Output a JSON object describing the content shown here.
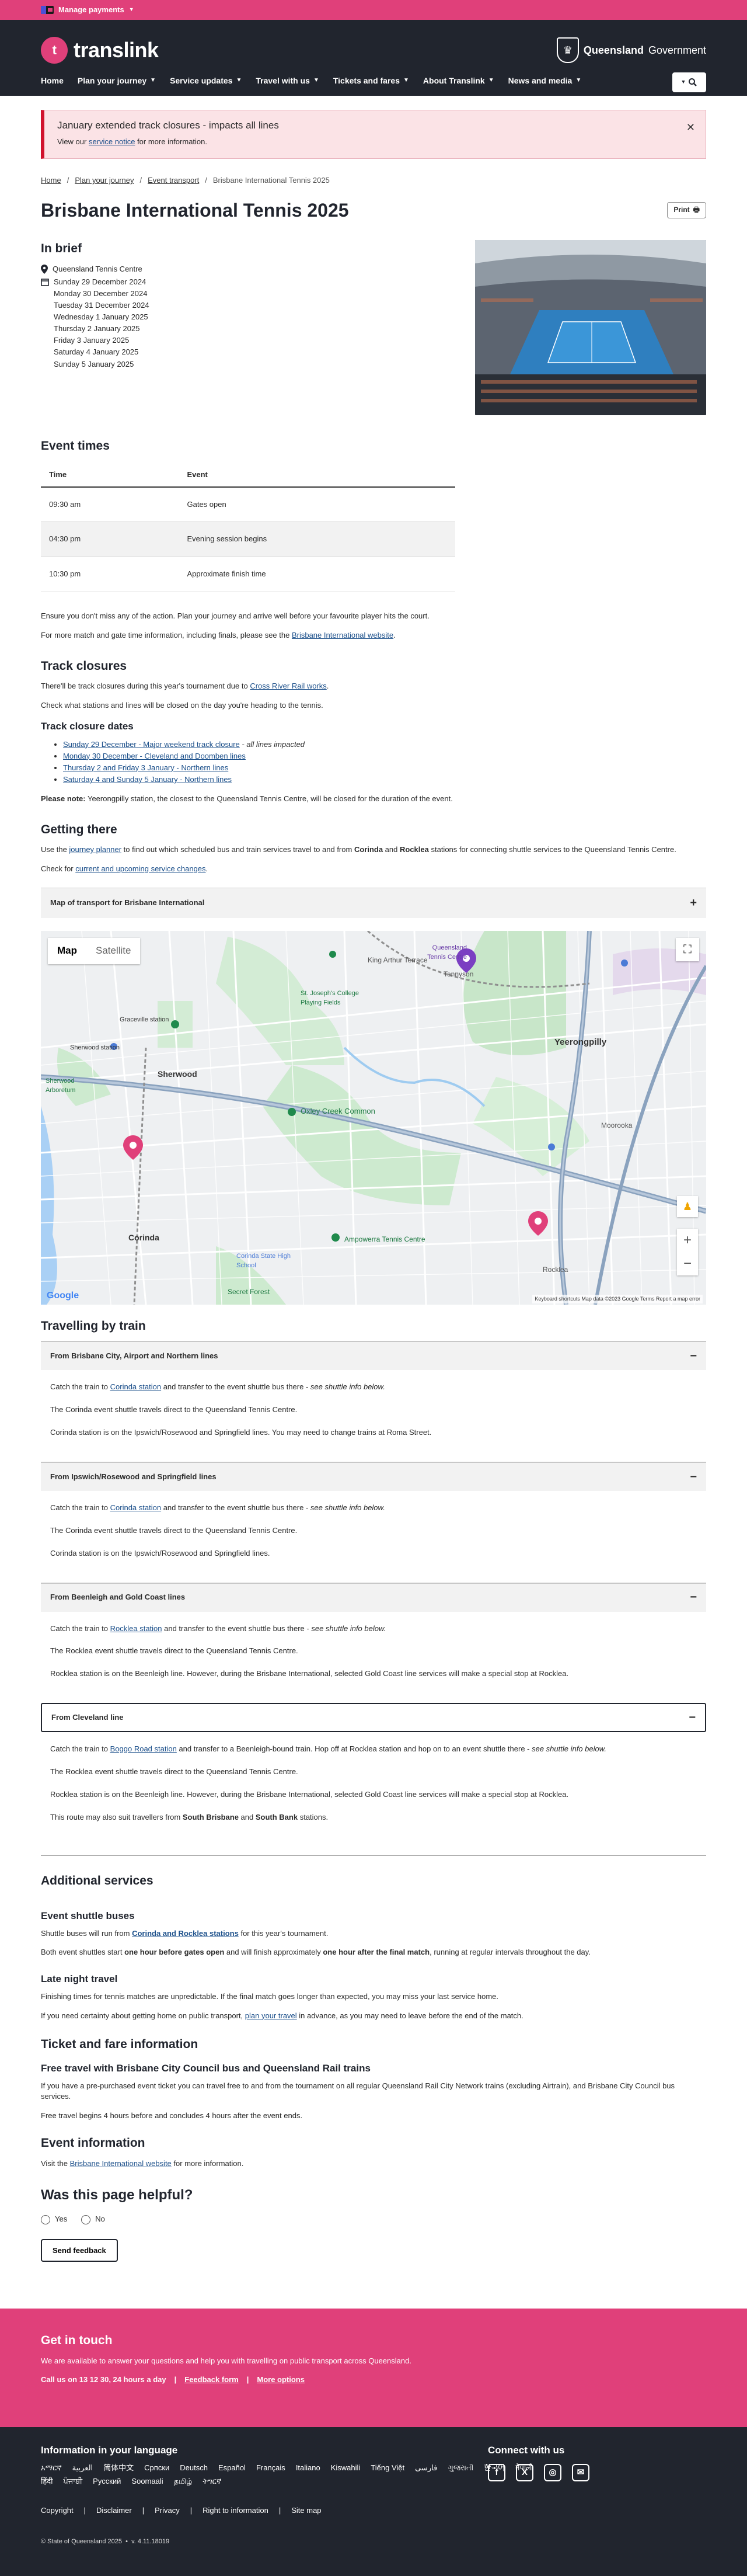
{
  "utility": {
    "manage_payments": "Manage payments"
  },
  "header": {
    "logo": "translink",
    "gov1": "Queensland",
    "gov2": "Government",
    "nav": [
      "Home",
      "Plan your journey",
      "Service updates",
      "Travel with us",
      "Tickets and fares",
      "About Translink",
      "News and media"
    ]
  },
  "alert": {
    "title": "January extended track closures - impacts all lines",
    "body_pre": "View our ",
    "body_link": "service notice",
    "body_post": " for more information."
  },
  "breadcrumb": [
    "Home",
    "Plan your journey",
    "Event transport",
    "Brisbane International Tennis 2025"
  ],
  "page": {
    "title": "Brisbane International Tennis 2025",
    "print": "Print"
  },
  "brief": {
    "heading": "In brief",
    "venue": "Queensland Tennis Centre",
    "dates": [
      "Sunday 29 December 2024",
      "Monday 30 December 2024",
      "Tuesday 31 December 2024",
      "Wednesday 1 January 2025",
      "Thursday 2 January 2025",
      "Friday 3 January 2025",
      "Saturday 4 January 2025",
      "Sunday 5 January 2025"
    ]
  },
  "times": {
    "heading": "Event times",
    "col_time": "Time",
    "col_event": "Event",
    "rows": [
      {
        "time": "09:30 am",
        "event": "Gates open"
      },
      {
        "time": "04:30 pm",
        "event": "Evening session begins"
      },
      {
        "time": "10:30 pm",
        "event": "Approximate finish time"
      }
    ],
    "p1": "Ensure you don't miss any of the action. Plan your journey and arrive well before your favourite player hits the court.",
    "p2_pre": "For more match and gate time information, including finals, please see the ",
    "p2_link": "Brisbane International website",
    "p2_post": "."
  },
  "closures": {
    "heading": "Track closures",
    "p1_pre": "There'll be track closures during this year's tournament due to ",
    "p1_link": "Cross River Rail works",
    "p1_post": ".",
    "p2": "Check what stations and lines will be closed on the day you're heading to the tennis.",
    "sub": "Track closure dates",
    "items": [
      {
        "text": "Sunday 29 December - Major weekend track closure",
        "note": " - all lines impacted"
      },
      {
        "text": "Monday 30 December - Cleveland and Doomben lines",
        "note": ""
      },
      {
        "text": "Thursday 2 and Friday 3 January - Northern lines",
        "note": ""
      },
      {
        "text": "Saturday 4 and Sunday 5 January - Northern lines",
        "note": ""
      }
    ],
    "note_bold": "Please note:",
    "note_text": " Yeerongpilly station, the closest to the Queensland Tennis Centre, will be closed for the duration of the event."
  },
  "getting": {
    "heading": "Getting there",
    "p1_pre": "Use the ",
    "p1_link": "journey planner",
    "p1_mid": " to find out which scheduled bus and train services travel to and from ",
    "p1_b1": "Corinda",
    "p1_and": " and ",
    "p1_b2": "Rocklea",
    "p1_post": " stations for connecting shuttle services to the Queensland Tennis Centre.",
    "p2_pre": "Check for ",
    "p2_link": "current and upcoming service changes",
    "p2_post": "."
  },
  "map": {
    "accordion": "Map of transport for Brisbane International",
    "tab_map": "Map",
    "tab_sat": "Satellite",
    "labels": [
      "Sherwood",
      "Corinda",
      "Yeerongpilly",
      "Moorooka",
      "Rocklea",
      "Oxley Creek Common",
      "Queensland Tennis Centre",
      "Tennyson",
      "St. Joseph's College Playing Fields",
      "Sherwood Arboretum",
      "Corinda State High School",
      "Secret Forest",
      "Ampowerra Tennis Centre",
      "King Arthur Terrace",
      "Sherwood station",
      "Graceville station"
    ],
    "google": "Google",
    "copy": "Keyboard shortcuts   Map data ©2023 Google   Terms   Report a map error"
  },
  "train": {
    "heading": "Travelling by train",
    "sections": [
      {
        "title": "From Brisbane City, Airport and Northern lines",
        "l1_pre": "Catch the train to ",
        "l1_link": "Corinda station",
        "l1_post": " and transfer to the event shuttle bus there - ",
        "l1_em": "see shuttle info below.",
        "l2": "The Corinda event shuttle travels direct to the Queensland Tennis Centre.",
        "l3": "Corinda station is on the Ipswich/Rosewood and Springfield lines. You may need to change trains at Roma Street."
      },
      {
        "title": "From Ipswich/Rosewood and Springfield lines",
        "l1_pre": "Catch the train to ",
        "l1_link": "Corinda station",
        "l1_post": " and transfer to the event shuttle bus there - ",
        "l1_em": "see shuttle info below.",
        "l2": "The Corinda event shuttle travels direct to the Queensland Tennis Centre.",
        "l3": "Corinda station is on the Ipswich/Rosewood and Springfield lines."
      },
      {
        "title": "From Beenleigh and Gold Coast lines",
        "l1_pre": "Catch the train to ",
        "l1_link": "Rocklea station",
        "l1_post": " and transfer to the event shuttle bus there - ",
        "l1_em": "see shuttle info below.",
        "l2": "The Rocklea event shuttle travels direct to the Queensland Tennis Centre.",
        "l3": "Rocklea station is on the Beenleigh line. However, during the Brisbane International, selected Gold Coast line services will make a special stop at Rocklea."
      },
      {
        "title": "From Cleveland line",
        "l1_pre": "Catch the train to ",
        "l1_link": "Boggo Road station",
        "l1_post": " and transfer to a Beenleigh-bound train. Hop off at Rocklea station and hop on to an event shuttle there - ",
        "l1_em": "see shuttle info below.",
        "l2": "The Rocklea event shuttle travels direct to the Queensland Tennis Centre.",
        "l3": "Rocklea station is on the Beenleigh line. However, during the Brisbane International, selected Gold Coast line services will make a special stop at Rocklea.",
        "l4_pre": "This route may also suit travellers from ",
        "l4_b1": "South Brisbane",
        "l4_and": " and ",
        "l4_b2": "South Bank",
        "l4_post": " stations."
      }
    ]
  },
  "additional": {
    "heading": "Additional services",
    "shuttle_h": "Event shuttle buses",
    "shuttle_p1_pre": "Shuttle buses will run from ",
    "shuttle_p1_b": "Corinda and Rocklea stations",
    "shuttle_p1_post": " for this year's tournament.",
    "shuttle_p2_pre": "Both event shuttles start ",
    "shuttle_p2_b1": "one hour before gates open",
    "shuttle_p2_mid": " and will finish approximately ",
    "shuttle_p2_b2": "one hour after the final match",
    "shuttle_p2_post": ", running at regular intervals throughout the day.",
    "late_h": "Late night travel",
    "late_p1": "Finishing times for tennis matches are unpredictable. If the final match goes longer than expected, you may miss your last service home.",
    "late_p2_pre": "If you need certainty about getting home on public transport, ",
    "late_p2_link": "plan your travel",
    "late_p2_post": " in advance, as you may need to leave before the end of the match.",
    "ticket_h": "Ticket and fare information",
    "free_h": "Free travel with Brisbane City Council bus and Queensland Rail trains",
    "free_p1": "If you have a pre-purchased event ticket you can travel free to and from the tournament on all regular Queensland Rail City Network trains (excluding Airtrain), and Brisbane City Council bus services.",
    "free_p2": "Free travel begins 4 hours before and concludes 4 hours after the event ends.",
    "info_h": "Event information",
    "info_p_pre": "Visit the ",
    "info_p_link": "Brisbane International website",
    "info_p_post": " for more information."
  },
  "feedback": {
    "heading": "Was this page helpful?",
    "yes": "Yes",
    "no": "No",
    "send": "Send feedback"
  },
  "touch": {
    "heading": "Get in touch",
    "body": "We are available to answer your questions and help you with travelling on public transport across Queensland.",
    "call": "Call us on 13 12 30, 24 hours a day",
    "feedback": "Feedback form",
    "more": "More options"
  },
  "footer": {
    "lang_heading": "Information in your language",
    "langs": [
      "አማርኛ",
      "العربية",
      "简体中文",
      "Српски",
      "Deutsch",
      "Español",
      "Français",
      "Italiano",
      "Kiswahili",
      "Tiếng Việt",
      "فارسی",
      "ગુજરાતી",
      "한국어",
      "नेपाली",
      "हिंदी",
      "ਪੰਜਾਬੀ",
      "Русский",
      "Soomaali",
      "தமிழ்",
      "ትግርኛ"
    ],
    "connect": "Connect with us",
    "links": [
      "Copyright",
      "Disclaimer",
      "Privacy",
      "Right to information",
      "Site map"
    ],
    "copyright": "© State of Queensland 2025",
    "version": "v. 4.11.18019"
  }
}
